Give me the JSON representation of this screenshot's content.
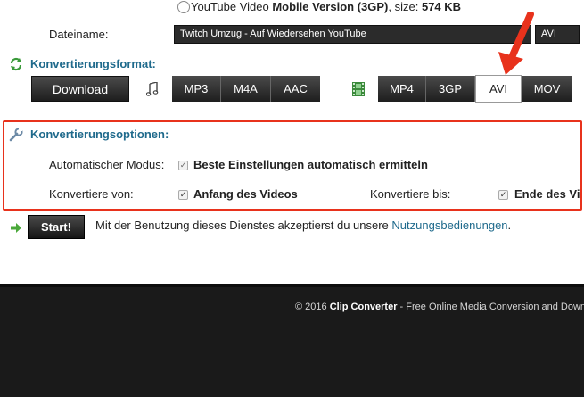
{
  "top": {
    "radio_label": "YouTube Video",
    "radio_bold": "Mobile Version (3GP)",
    "size_text": ", size:",
    "size_value": "574 KB"
  },
  "filename": {
    "label": "Dateiname:",
    "value": "Twitch Umzug - Auf Wiedersehen YouTube",
    "extension": "AVI"
  },
  "format": {
    "title": "Konvertierungsformat:",
    "download_label": "Download",
    "audio_icon": "music-note-icon",
    "audio_formats": [
      "MP3",
      "M4A",
      "AAC"
    ],
    "video_icon": "film-strip-icon",
    "video_formats": [
      "MP4",
      "3GP",
      "AVI",
      "MOV"
    ],
    "selected_video_format": "AVI"
  },
  "options": {
    "title": "Konvertierungsoptionen:",
    "auto_label": "Automatischer Modus:",
    "auto_checkbox_label": "Beste Einstellungen automatisch ermitteln",
    "from_label": "Konvertiere von:",
    "from_checkbox_label": "Anfang des Videos",
    "to_label": "Konvertiere bis:",
    "to_checkbox_label": "Ende des Vi"
  },
  "start": {
    "button_label": "Start!",
    "terms_text": "Mit der Benutzung dieses Dienstes akzeptierst du unsere",
    "terms_link": "Nutzungsbedienungen",
    "terms_end": "."
  },
  "footer": {
    "copyright": "© 2016",
    "brand": "Clip Converter",
    "tagline": " - Free Online Media Conversion and Down"
  },
  "colors": {
    "accent_blue": "#1f6a8c",
    "highlight_red": "#e8321c",
    "footer_bg": "#1a1a1a",
    "button_dark": "#2b2b2b"
  }
}
